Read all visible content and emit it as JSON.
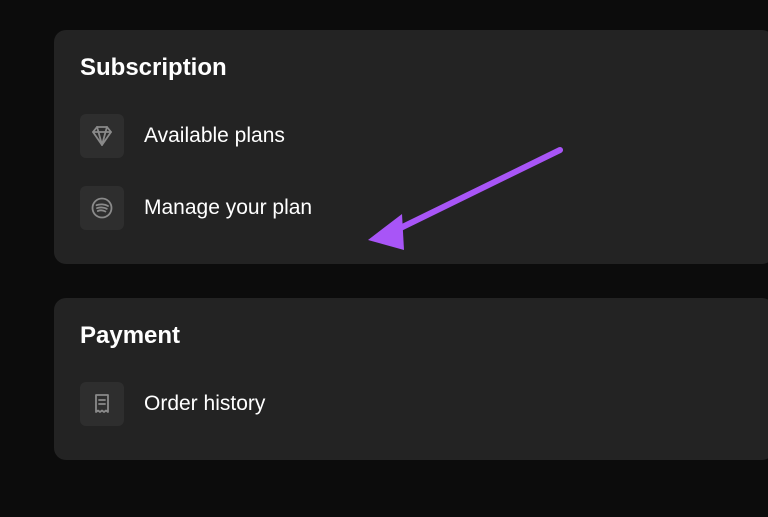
{
  "sections": {
    "subscription": {
      "title": "Subscription",
      "items": [
        {
          "label": "Available plans"
        },
        {
          "label": "Manage your plan"
        }
      ]
    },
    "payment": {
      "title": "Payment",
      "items": [
        {
          "label": "Order history"
        }
      ]
    }
  },
  "annotation": {
    "color": "#a855f7"
  }
}
